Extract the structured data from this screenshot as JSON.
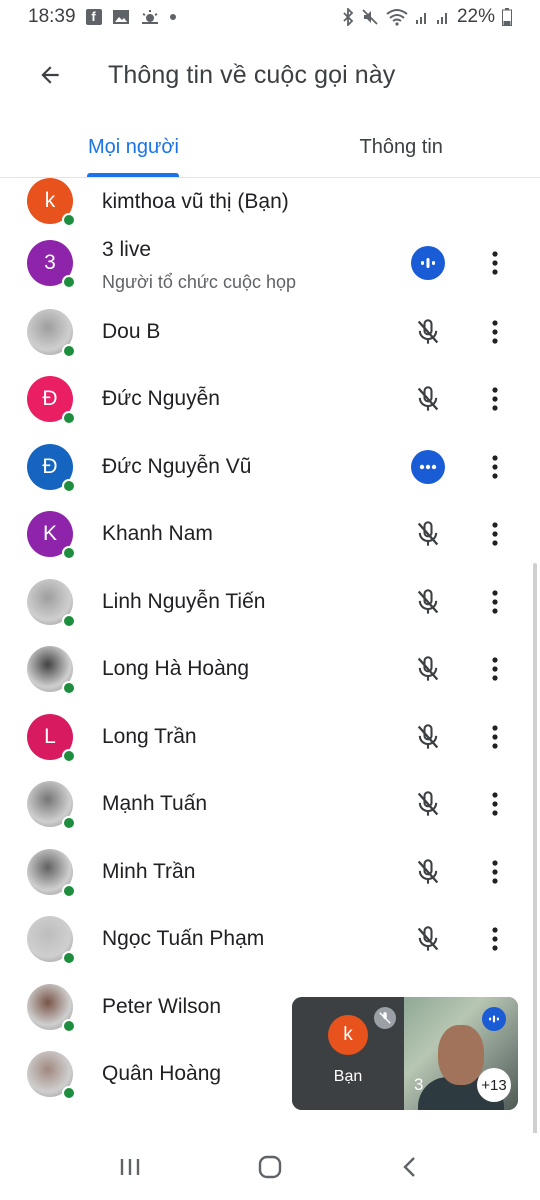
{
  "status_bar": {
    "time": "18:39",
    "battery": "22%",
    "icons": [
      "facebook-icon",
      "gallery-icon",
      "weather-icon",
      "dot-icon",
      "bluetooth-icon",
      "mute-icon",
      "wifi-icon",
      "signal-icon",
      "signal-icon",
      "battery-icon"
    ]
  },
  "app_bar": {
    "title": "Thông tin về cuộc gọi này",
    "back_icon": "arrow-back-icon"
  },
  "tabs": [
    {
      "label": "Mọi người",
      "active": true
    },
    {
      "label": "Thông tin",
      "active": false
    }
  ],
  "participants": [
    {
      "name": "kimthoa vũ thị (Bạn)",
      "initial": "k",
      "avatar_color": "#e8521c",
      "photo": false,
      "status": "none"
    },
    {
      "name": "3 live",
      "subtitle": "Người tổ chức cuộc họp",
      "initial": "3",
      "avatar_color": "#8e24aa",
      "photo": false,
      "status": "speaking"
    },
    {
      "name": "Dou B",
      "initial": "",
      "avatar_color": "#9e9e9e",
      "photo": true,
      "status": "muted"
    },
    {
      "name": "Đức Nguyễn",
      "initial": "Đ",
      "avatar_color": "#e91e63",
      "photo": false,
      "status": "muted"
    },
    {
      "name": "Đức Nguyễn Vũ",
      "initial": "Đ",
      "avatar_color": "#1565c0",
      "photo": false,
      "status": "speaking-dots"
    },
    {
      "name": "Khanh Nam",
      "initial": "K",
      "avatar_color": "#8e24aa",
      "photo": false,
      "status": "muted"
    },
    {
      "name": "Linh Nguyễn Tiến",
      "initial": "",
      "avatar_color": "#9e9e9e",
      "photo": true,
      "status": "muted"
    },
    {
      "name": "Long Hà Hoàng",
      "initial": "",
      "avatar_color": "#424242",
      "photo": true,
      "status": "muted"
    },
    {
      "name": "Long Trần",
      "initial": "L",
      "avatar_color": "#d81b60",
      "photo": false,
      "status": "muted"
    },
    {
      "name": "Mạnh Tuấn",
      "initial": "",
      "avatar_color": "#757575",
      "photo": true,
      "status": "muted"
    },
    {
      "name": "Minh Trần",
      "initial": "",
      "avatar_color": "#616161",
      "photo": true,
      "status": "muted"
    },
    {
      "name": "Ngọc Tuấn Phạm",
      "initial": "",
      "avatar_color": "#bdbdbd",
      "photo": true,
      "status": "muted"
    },
    {
      "name": "Peter Wilson",
      "initial": "",
      "avatar_color": "#795548",
      "photo": true,
      "status": "none"
    },
    {
      "name": "Quân Hoàng",
      "initial": "",
      "avatar_color": "#a1887f",
      "photo": true,
      "status": "none"
    }
  ],
  "self_preview": {
    "initial": "k",
    "label": "Bạn",
    "video_number": "3",
    "more_count": "+13"
  },
  "nav_bar": {
    "icons": [
      "recent-apps-icon",
      "home-icon",
      "back-icon"
    ]
  },
  "colors": {
    "accent": "#1a73e8",
    "online": "#1e8e3e",
    "speaking": "#1a5bd6"
  }
}
